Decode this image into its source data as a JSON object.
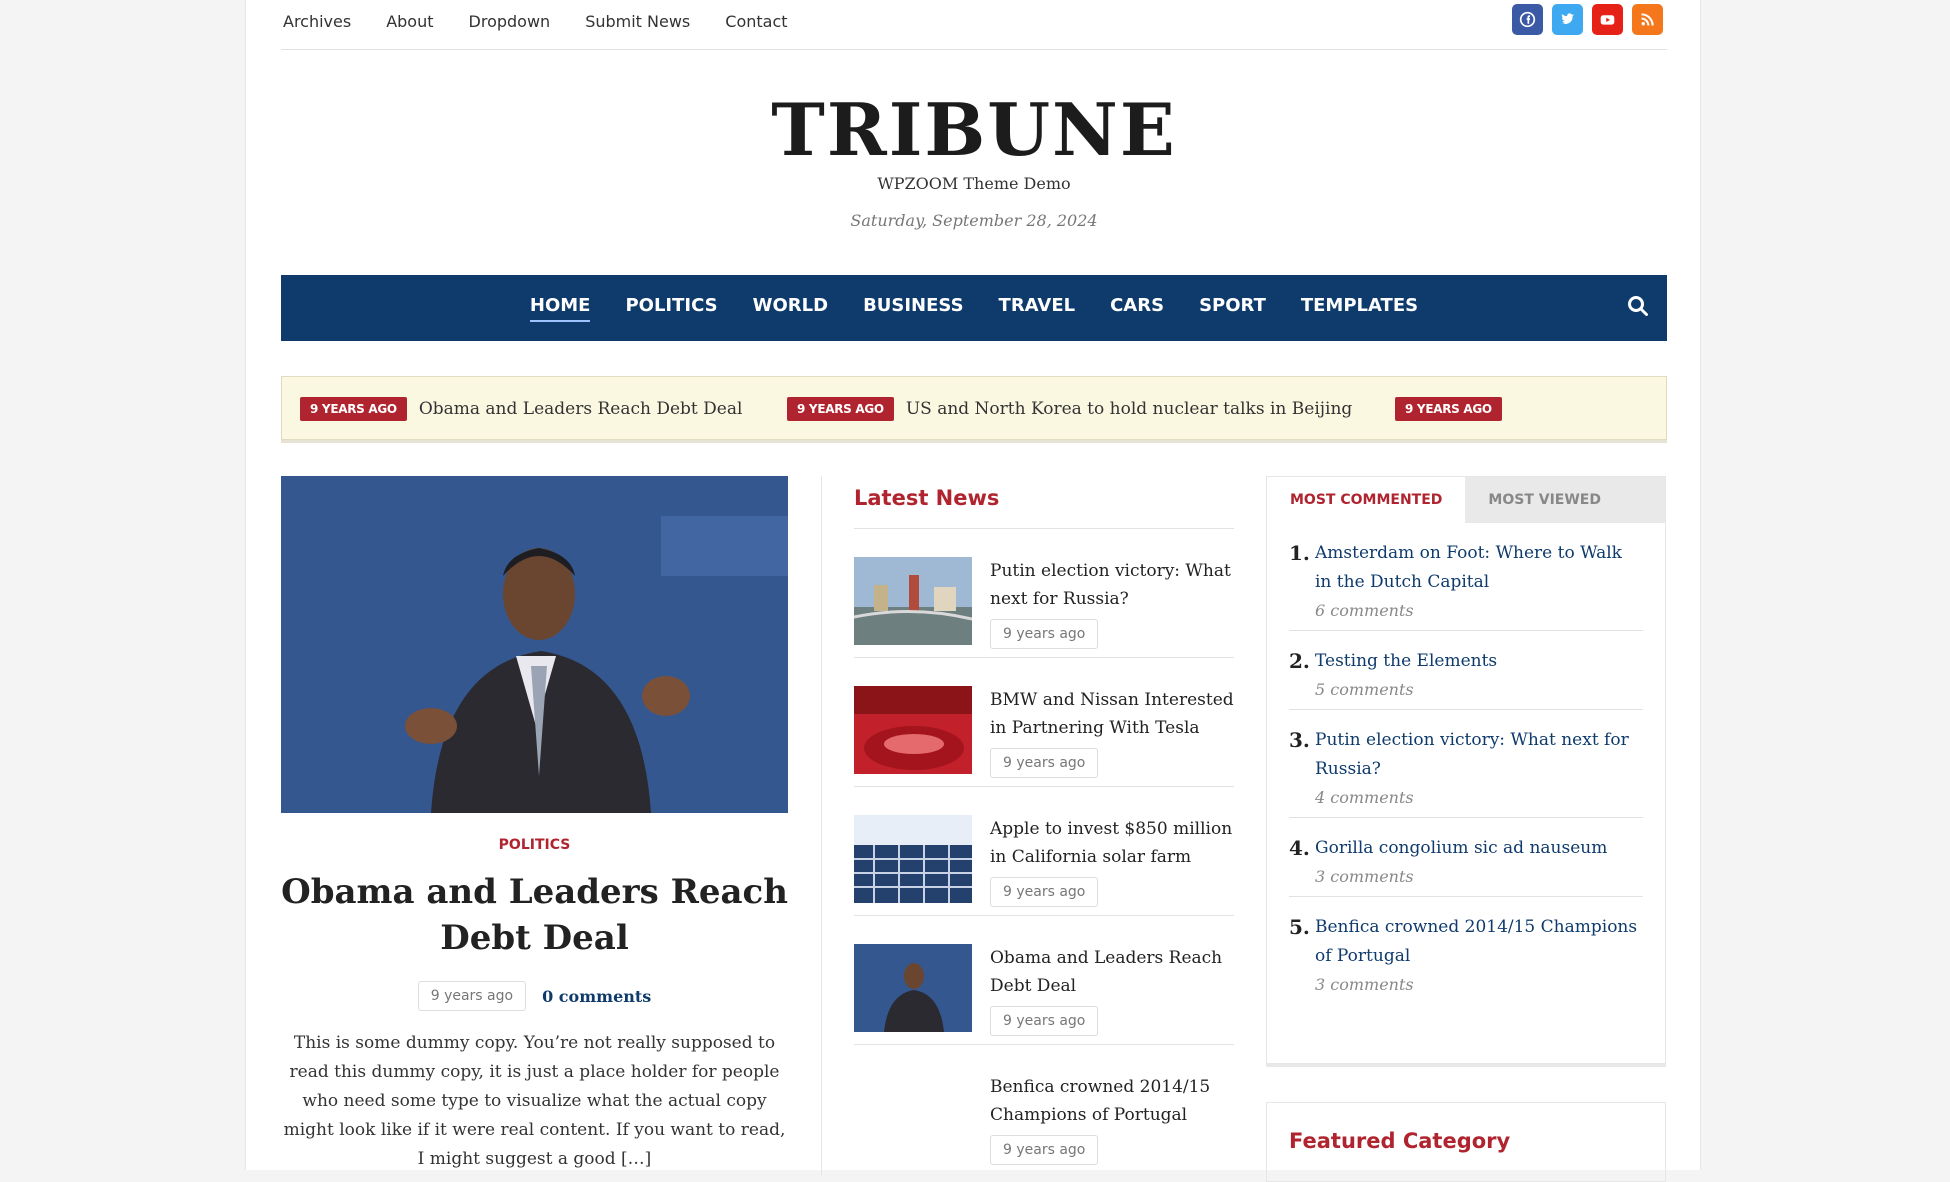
{
  "topnav": [
    "Archives",
    "About",
    "Dropdown",
    "Submit News",
    "Contact"
  ],
  "social": {
    "facebook_color": "#3b5aa5",
    "twitter_color": "#3ea9f0",
    "youtube_color": "#e62117",
    "rss_color": "#f5771b"
  },
  "site": {
    "title": "TRIBUNE",
    "tagline": "WPZOOM Theme Demo",
    "date": "Saturday, September 28, 2024"
  },
  "mainnav": [
    "HOME",
    "POLITICS",
    "WORLD",
    "BUSINESS",
    "TRAVEL",
    "CARS",
    "SPORT",
    "TEMPLATES"
  ],
  "ticker": [
    {
      "badge": "9 YEARS AGO",
      "title": "Obama and Leaders Reach Debt Deal"
    },
    {
      "badge": "9 YEARS AGO",
      "title": "US and North Korea to hold nuclear talks in Beijing"
    },
    {
      "badge": "9 YEARS AGO",
      "title": ""
    }
  ],
  "featured": {
    "category": "POLITICS",
    "title": "Obama and Leaders Reach Debt Deal",
    "time": "9 years ago",
    "comments": "0 comments",
    "excerpt": "This is some dummy copy. You’re not really supposed to read this dummy copy, it is just a place holder for people who need some type to visualize what the actual copy might look like if it were real content. If you want to read, I might suggest a good […]"
  },
  "latest": {
    "heading": "Latest News",
    "items": [
      {
        "title": "Putin election victory: What next for Russia?",
        "time": "9 years ago"
      },
      {
        "title": "BMW and Nissan Interested in Partnering With Tesla",
        "time": "9 years ago"
      },
      {
        "title": "Apple to invest $850 million in California solar farm",
        "time": "9 years ago"
      },
      {
        "title": "Obama and Leaders Reach Debt Deal",
        "time": "9 years ago"
      },
      {
        "title": "Benfica crowned 2014/15 Champions of Portugal",
        "time": "9 years ago"
      }
    ]
  },
  "sidebar": {
    "tabs": [
      "MOST COMMENTED",
      "MOST VIEWED"
    ],
    "items": [
      {
        "rank": "1.",
        "title": "Amsterdam on Foot: Where to Walk in the Dutch Capital",
        "comments": "6 comments"
      },
      {
        "rank": "2.",
        "title": "Testing the Elements",
        "comments": "5 comments"
      },
      {
        "rank": "3.",
        "title": "Putin election victory: What next for Russia?",
        "comments": "4 comments"
      },
      {
        "rank": "4.",
        "title": "Gorilla congolium sic ad nauseum",
        "comments": "3 comments"
      },
      {
        "rank": "5.",
        "title": "Benfica crowned 2014/15 Champions of Portugal",
        "comments": "3 comments"
      }
    ],
    "featured_category": "Featured Category"
  },
  "colors": {
    "nav_bg": "#0e3a6c",
    "accent_red": "#b0242f",
    "ticker_bg": "#fbf8e2"
  }
}
